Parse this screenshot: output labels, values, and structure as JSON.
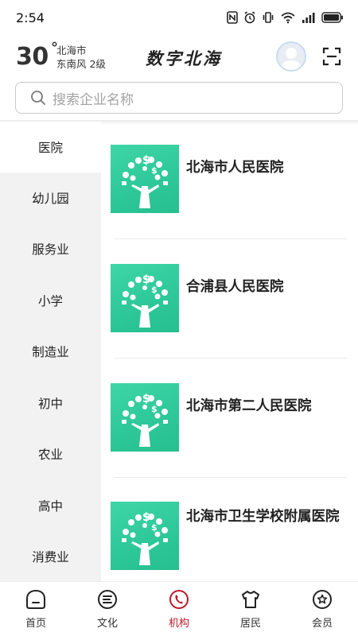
{
  "status_bar": {
    "time": "2:54",
    "icons": [
      "nfc-icon",
      "alarm-icon",
      "vibrate-icon",
      "wifi-icon",
      "signal-icon",
      "battery-icon"
    ]
  },
  "header": {
    "temperature": "30",
    "degree_symbol": "°",
    "city": "北海市",
    "wind": "东南风  2级",
    "app_title": "数字北海"
  },
  "search": {
    "placeholder": "搜索企业名称"
  },
  "sidebar": {
    "categories": [
      {
        "label": "医院",
        "active": true
      },
      {
        "label": "幼儿园",
        "active": false
      },
      {
        "label": "服务业",
        "active": false
      },
      {
        "label": "小学",
        "active": false
      },
      {
        "label": "制造业",
        "active": false
      },
      {
        "label": "初中",
        "active": false
      },
      {
        "label": "农业",
        "active": false
      },
      {
        "label": "高中",
        "active": false
      },
      {
        "label": "消费业",
        "active": false
      }
    ]
  },
  "list": {
    "items": [
      {
        "name": "北海市人民医院",
        "icon": "money-tree-icon"
      },
      {
        "name": "合浦县人民医院",
        "icon": "money-tree-icon"
      },
      {
        "name": "北海市第二人民医院",
        "icon": "money-tree-icon"
      },
      {
        "name": "北海市卫生学校附属医院",
        "icon": "money-tree-icon"
      }
    ]
  },
  "bottom_nav": {
    "items": [
      {
        "label": "首页",
        "icon": "home-icon",
        "active": false
      },
      {
        "label": "文化",
        "icon": "culture-icon",
        "active": false
      },
      {
        "label": "机构",
        "icon": "institution-icon",
        "active": true
      },
      {
        "label": "居民",
        "icon": "resident-icon",
        "active": false
      },
      {
        "label": "会员",
        "icon": "member-icon",
        "active": false
      }
    ],
    "active_color": "#b8192a",
    "inactive_color": "#333333"
  },
  "colors": {
    "thumb_green": "#2ec89a",
    "sidebar_bg": "#f2f2f2",
    "accent": "#b8192a"
  }
}
